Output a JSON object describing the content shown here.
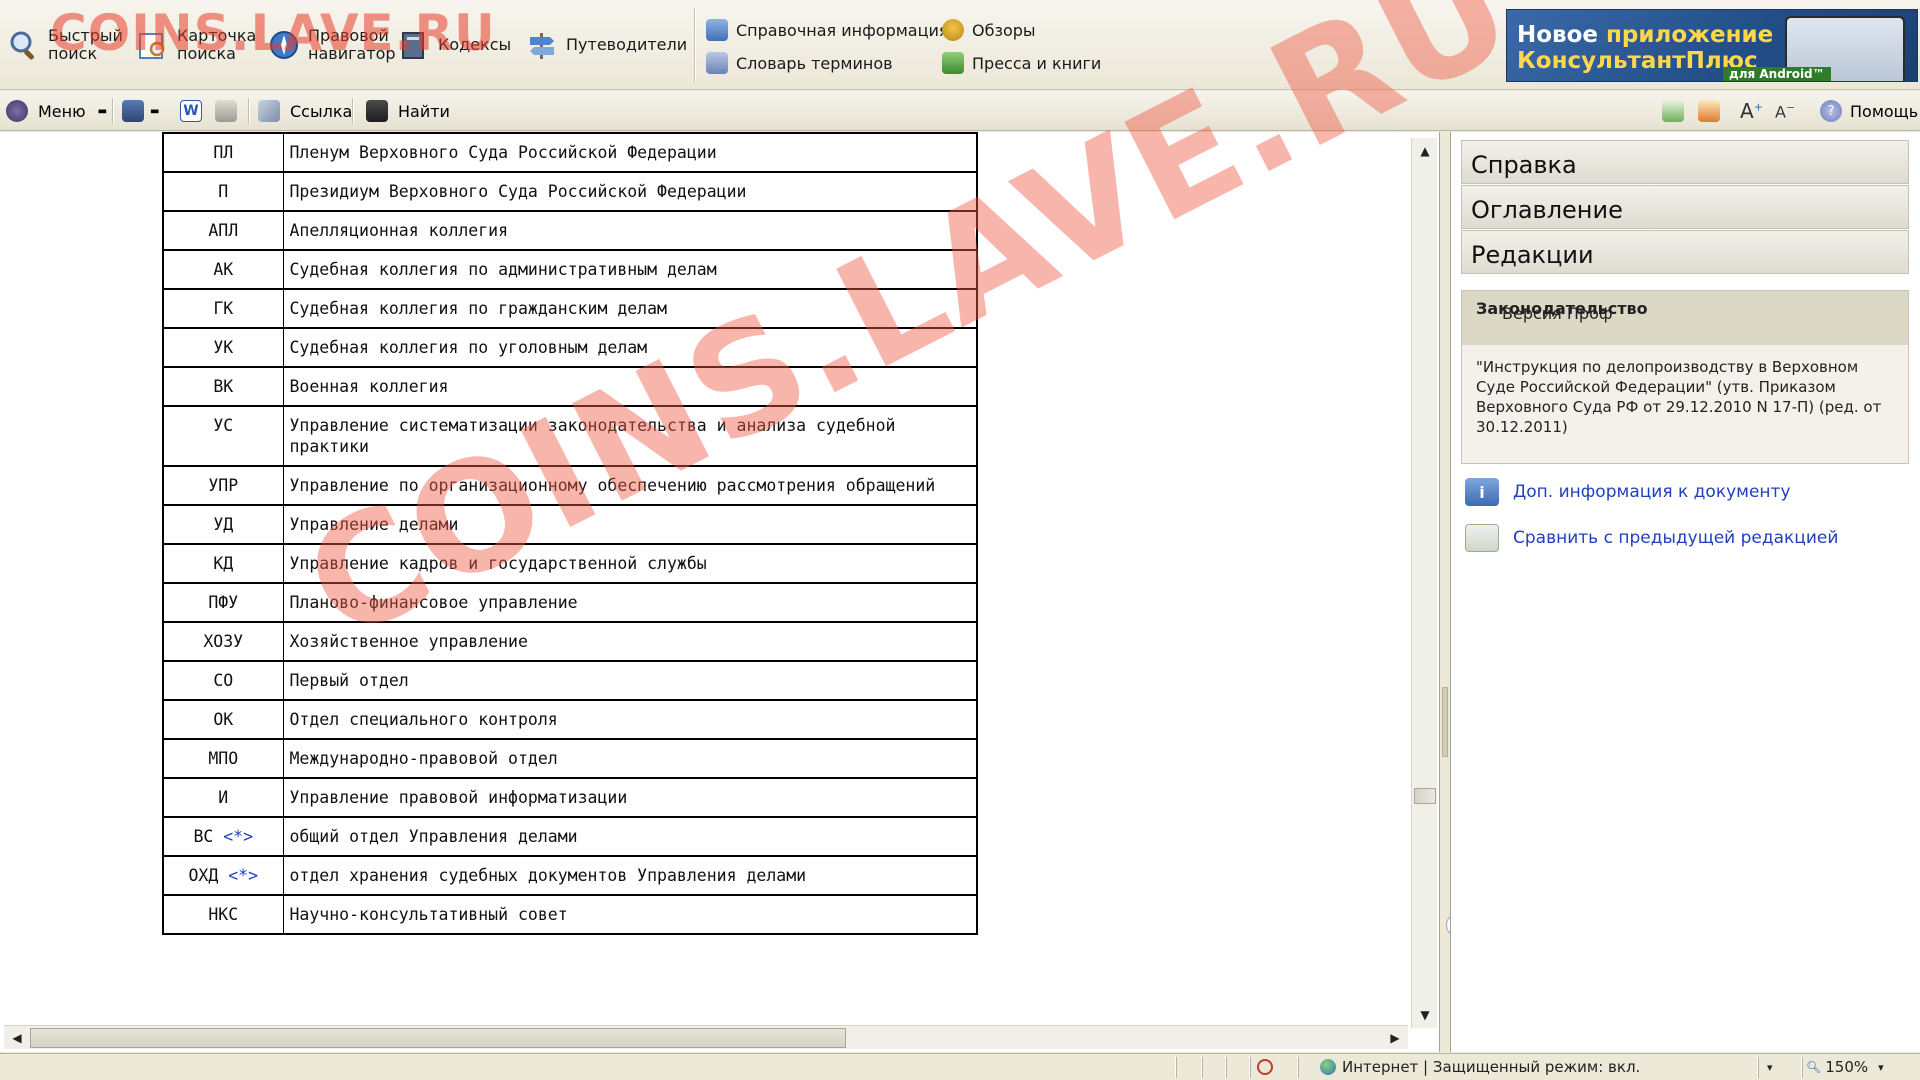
{
  "toolbar": {
    "quick_search": "Быстрый\nпоиск",
    "search_card": "Карточка\nпоиска",
    "legal_navigator": "Правовой\nнавигатор",
    "codes": "Кодексы",
    "guides": "Путеводители",
    "reference_info": "Справочная информация",
    "glossary": "Словарь терминов",
    "reviews": "Обзоры",
    "press_books": "Пресса и книги"
  },
  "ad_banner": {
    "line1_a": "Новое ",
    "line1_b": "приложение",
    "line2": "КонсультантПлюс",
    "line3": "для Android™"
  },
  "toolbar2": {
    "menu": "Меню",
    "link": "Ссылка",
    "find": "Найти",
    "help": "Помощь"
  },
  "document": {
    "rows": [
      {
        "code": "ПЛ",
        "name": "Пленум Верховного Суда Российской Федерации"
      },
      {
        "code": "П",
        "name": "Президиум Верховного Суда Российской Федерации"
      },
      {
        "code": "АПЛ",
        "name": "Апелляционная коллегия"
      },
      {
        "code": "АК",
        "name": "Судебная коллегия по административным делам"
      },
      {
        "code": "ГК",
        "name": "Судебная коллегия по гражданским делам"
      },
      {
        "code": "УК",
        "name": "Судебная коллегия по уголовным делам"
      },
      {
        "code": "ВК",
        "name": "Военная коллегия"
      },
      {
        "code": "УС",
        "name": "Управление систематизации законодательства и анализа судебной практики"
      },
      {
        "code": "УПР",
        "name": "Управление по организационному обеспечению рассмотрения обращений"
      },
      {
        "code": "УД",
        "name": "Управление делами"
      },
      {
        "code": "КД",
        "name": "Управление кадров и государственной службы"
      },
      {
        "code": "ПФУ",
        "name": "Планово-финансовое управление"
      },
      {
        "code": "ХОЗУ",
        "name": "Хозяйственное управление"
      },
      {
        "code": "СО",
        "name": "Первый отдел"
      },
      {
        "code": "ОК",
        "name": "Отдел специального контроля"
      },
      {
        "code": "МПО",
        "name": "Международно-правовой отдел"
      },
      {
        "code": "И",
        "name": "Управление правовой информатизации"
      },
      {
        "code": "ВС",
        "ref": "<*>",
        "name": "общий отдел Управления делами"
      },
      {
        "code": "ОХД",
        "ref": "<*>",
        "name": "отдел хранения судебных документов Управления делами"
      },
      {
        "code": "НКС",
        "name": "Научно-консультативный совет"
      }
    ]
  },
  "right_panel": {
    "tabs": [
      "Справка",
      "Оглавление",
      "Редакции"
    ],
    "info_title": "Законодательство",
    "info_subtitle": "Версия Проф",
    "info_text": "\"Инструкция по делопроизводству в Верховном Суде Российской Федерации\" (утв. Приказом Верховного Суда РФ от 29.12.2010 N 17-П) (ред. от 30.12.2011)",
    "link_more_info": "Доп. информация к документу",
    "link_compare": "Сравнить с предыдущей редакцией"
  },
  "statusbar": {
    "zone": "Интернет | Защищенный режим: вкл.",
    "zoom": "150%"
  },
  "watermark": {
    "top_text": "COINS.LAVE.RU",
    "diagonal_text": "COINS.LAVE.RU"
  },
  "colors": {
    "link": "#1f3fbf",
    "watermark": "#f05a46",
    "toolbar_bg": "#ece9d8"
  }
}
